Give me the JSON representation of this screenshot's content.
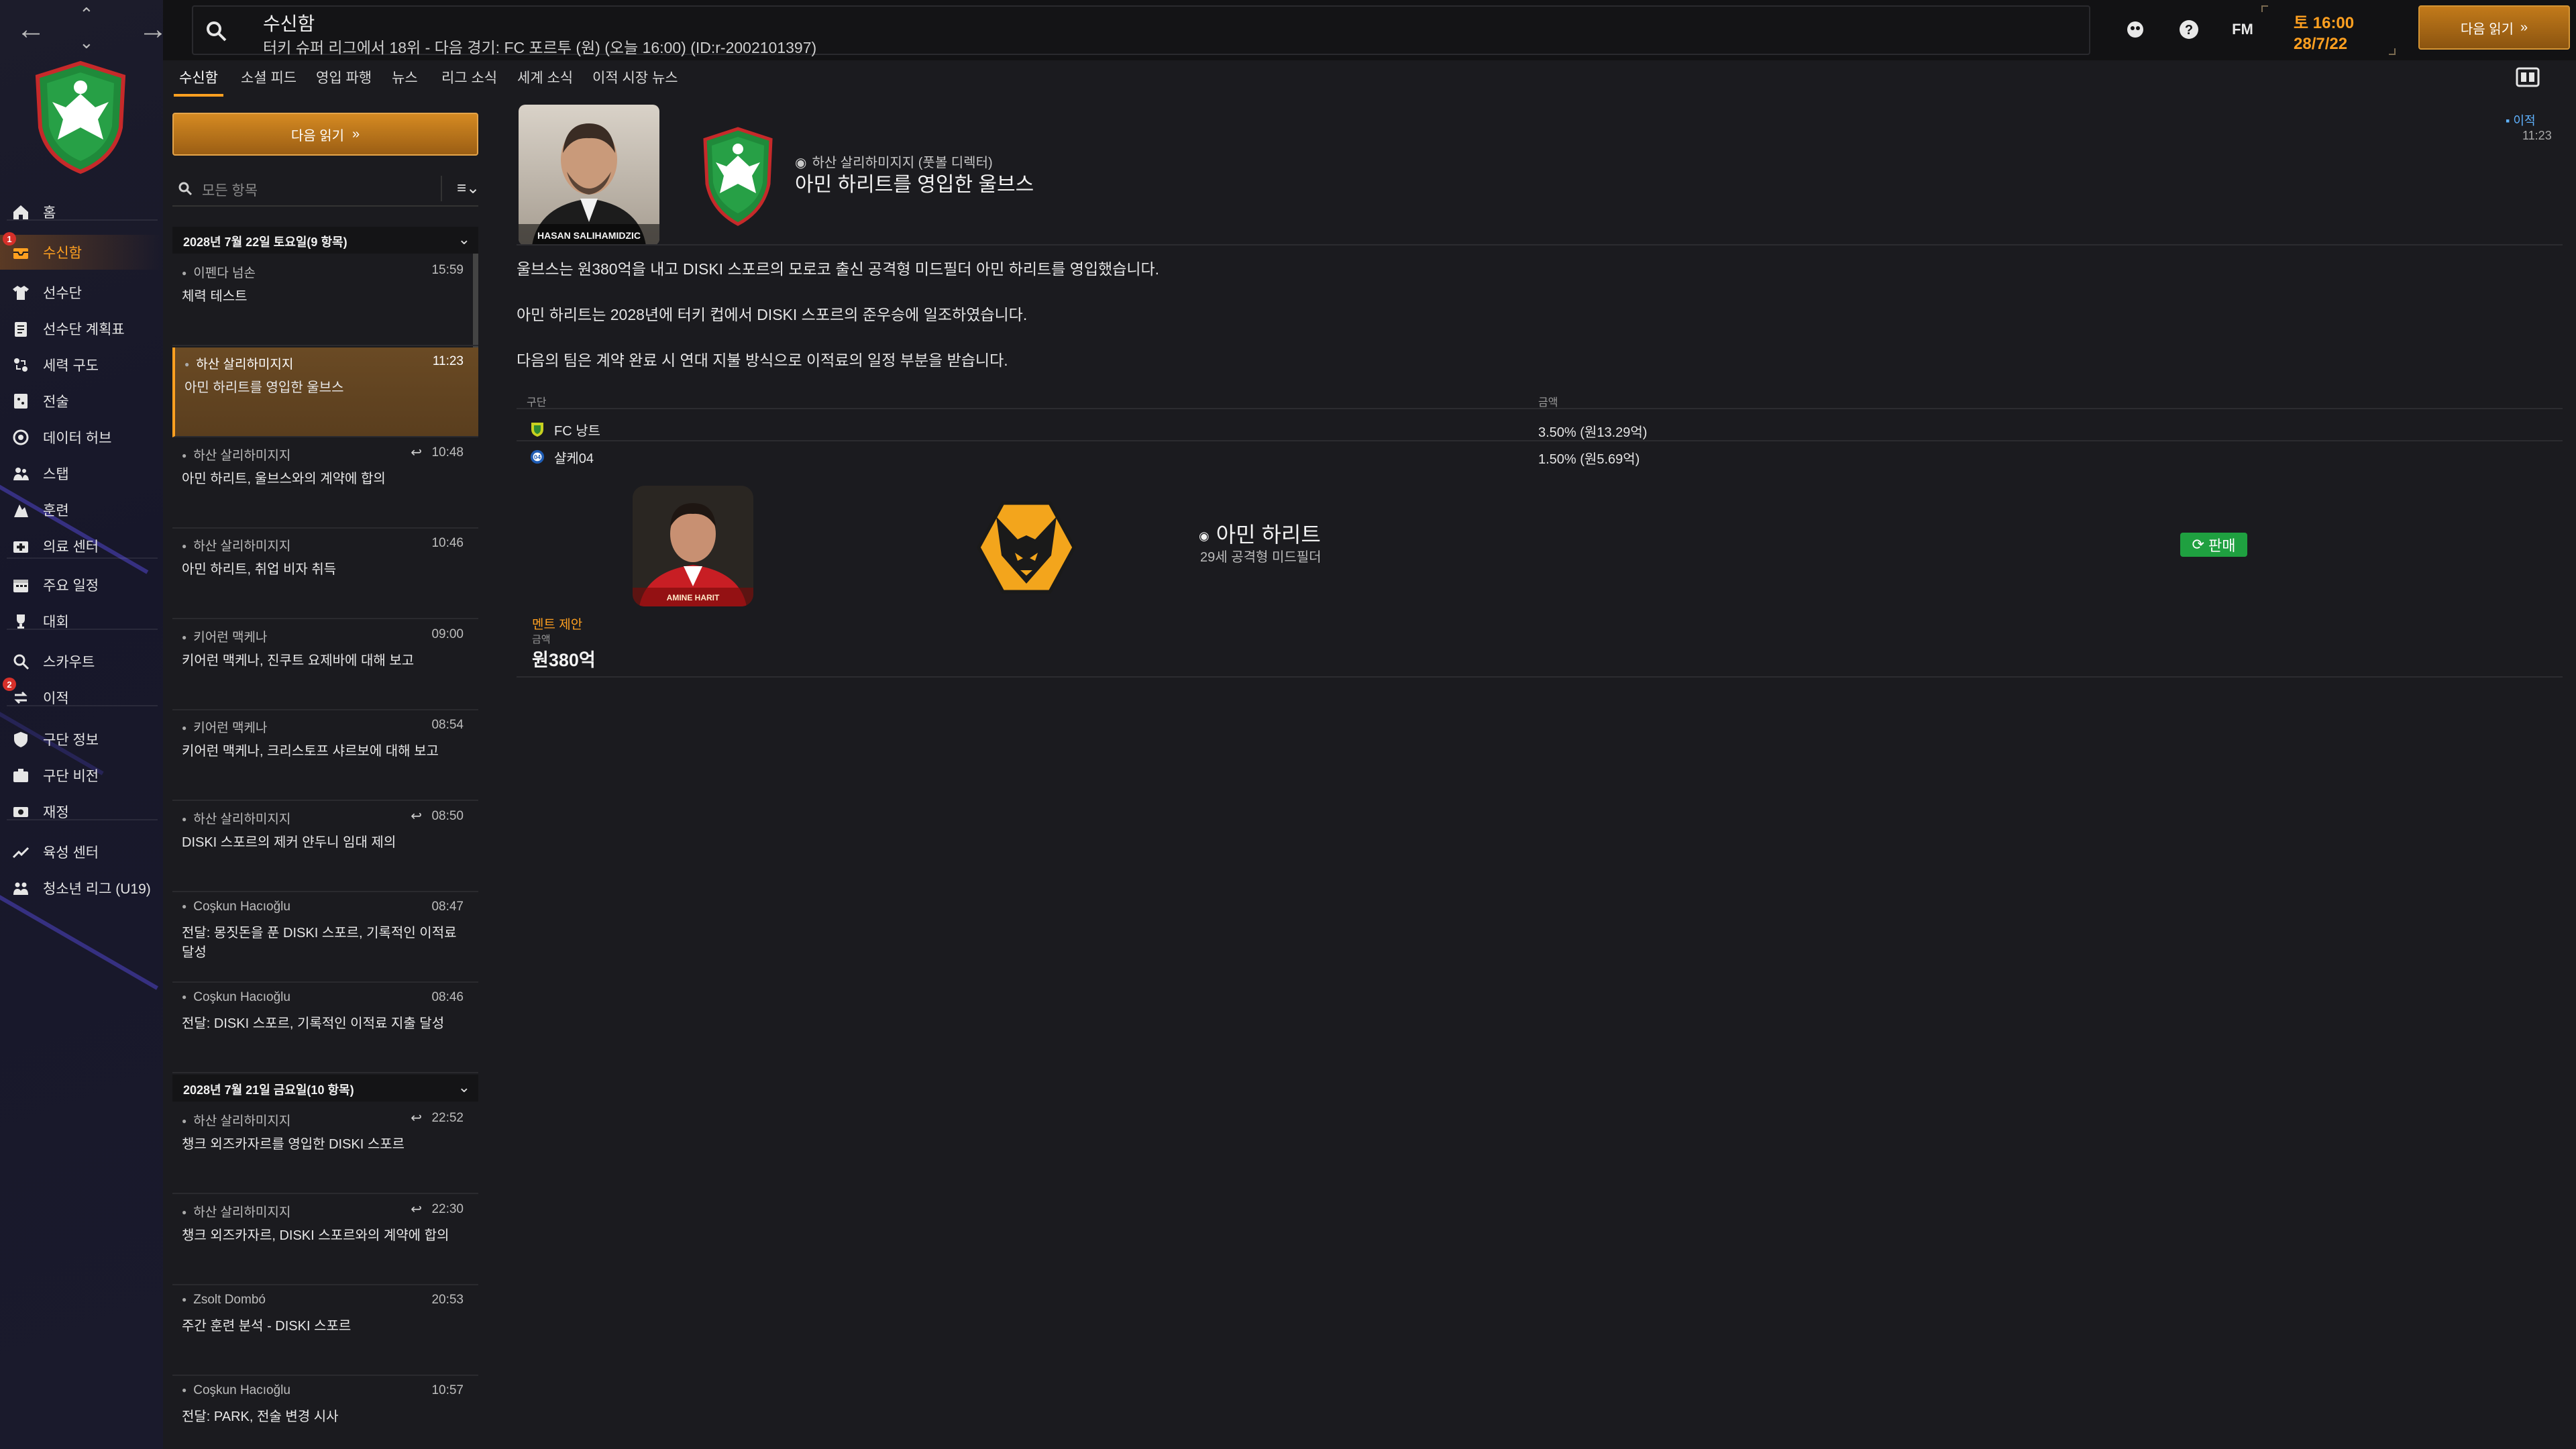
{
  "nav": {
    "back_icon": "arrow-left-icon",
    "forward_icon": "arrow-right-icon"
  },
  "topbar": {
    "title": "수신함",
    "subtitle": "터키 슈퍼 리그에서 18위 - 다음 경기: FC 포르투 (원) (오늘 16:00) (ID:r-2002101397)",
    "date_line1": "토 16:00",
    "date_line2": "28/7/22",
    "fm_label": "FM",
    "continue_label": "다음 읽기"
  },
  "sidebar": {
    "items": [
      {
        "label": "홈",
        "icon": "home-icon"
      },
      {
        "label": "수신함",
        "icon": "inbox-icon",
        "badge": "1",
        "active": true
      },
      {
        "label": "선수단",
        "icon": "shirt-icon"
      },
      {
        "label": "선수단 계획표",
        "icon": "clipboard-icon"
      },
      {
        "label": "세력 구도",
        "icon": "dynamics-icon"
      },
      {
        "label": "전술",
        "icon": "tactics-icon"
      },
      {
        "label": "데이터 허브",
        "icon": "data-hub-icon"
      },
      {
        "label": "스탭",
        "icon": "staff-icon"
      },
      {
        "label": "훈련",
        "icon": "training-icon"
      },
      {
        "label": "의료 센터",
        "icon": "medical-icon"
      },
      {
        "label": "주요 일정",
        "icon": "calendar-icon"
      },
      {
        "label": "대회",
        "icon": "trophy-icon"
      },
      {
        "label": "스카우트",
        "icon": "scouting-icon"
      },
      {
        "label": "이적",
        "icon": "transfers-icon",
        "badge": "2"
      },
      {
        "label": "구단 정보",
        "icon": "club-info-icon"
      },
      {
        "label": "구단 비전",
        "icon": "vision-icon"
      },
      {
        "label": "재정",
        "icon": "finances-icon"
      },
      {
        "label": "육성 센터",
        "icon": "development-icon"
      },
      {
        "label": "청소년 리그 (U19)",
        "icon": "youth-icon"
      }
    ]
  },
  "subnav": {
    "tabs": [
      "수신함",
      "소셜 피드",
      "영입 파행",
      "뉴스",
      "리그 소식",
      "세계 소식",
      "이적 시장 뉴스"
    ]
  },
  "inbox": {
    "continue_label": "다음 읽기",
    "filter_placeholder": "모든 항목",
    "groups": [
      {
        "header": "2028년 7월 22일 토요일(9 항목)"
      },
      {
        "header": "2028년 7월 21일 금요일(10 항목)"
      }
    ],
    "messages": [
      {
        "from": "이펜다 넘손",
        "time": "15:59",
        "subject": "체력 테스트",
        "reply": false
      },
      {
        "from": "하산 살리하미지지",
        "time": "11:23",
        "subject": "아민 하리트를 영입한 울브스",
        "reply": false
      },
      {
        "from": "하산 살리하미지지",
        "time": "10:48",
        "subject": "아민 하리트, 울브스와의 계약에 합의",
        "reply": true
      },
      {
        "from": "하산 살리하미지지",
        "time": "10:46",
        "subject": "아민 하리트, 취업 비자 취득",
        "reply": false
      },
      {
        "from": "키어런 맥케나",
        "time": "09:00",
        "subject": "키어런 맥케나, 진쿠트 요제바에 대해 보고",
        "reply": false
      },
      {
        "from": "키어런 맥케나",
        "time": "08:54",
        "subject": "키어런 맥케나, 크리스토프 샤르보에 대해 보고",
        "reply": false
      },
      {
        "from": "하산 살리하미지지",
        "time": "08:50",
        "subject": "DISKI 스포르의 제커 얀두니 임대 제의",
        "reply": true
      },
      {
        "from": "Coşkun Hacıoğlu",
        "time": "08:47",
        "subject": "전달: 몽짓돈을 푼 DISKI 스포르, 기록적인 이적료 달성",
        "reply": false
      },
      {
        "from": "Coşkun Hacıoğlu",
        "time": "08:46",
        "subject": "전달: DISKI 스포르, 기록적인 이적료 지출 달성",
        "reply": false
      },
      {
        "from": "하산 살리하미지지",
        "time": "22:52",
        "subject": "챙크 외즈카자르를 영입한 DISKI 스포르",
        "reply": true
      },
      {
        "from": "하산 살리하미지지",
        "time": "22:30",
        "subject": "챙크 외즈카자르, DISKI 스포르와의 계약에 합의",
        "reply": true
      },
      {
        "from": "Zsolt Dombó",
        "time": "20:53",
        "subject": "주간 훈련 분석 - DISKI 스포르",
        "reply": false
      },
      {
        "from": "Coşkun Hacıoğlu",
        "time": "10:57",
        "subject": "전달: PARK, 전술 변경 시사",
        "reply": false
      }
    ]
  },
  "message": {
    "photo_caption": "HASAN SALIHAMIDZIC",
    "from": "하산 살리하미지지 (풋볼 디렉터)",
    "title": "아민 하리트를 영입한 울브스",
    "tag": "이적",
    "time": "11:23",
    "paragraphs": [
      "울브스는 원380억을 내고 DISKI 스포르의 모로코 출신 공격형 미드필더 아민 하리트를 영입했습니다.",
      "아민 하리트는 2028년에 터키 컵에서 DISKI 스포르의 준우승에 일조하였습니다.",
      "다음의 팀은 계약 완료 시 연대 지불 방식으로 이적료의 일정 부분을 받습니다."
    ],
    "table": {
      "col_club": "구단",
      "col_amount": "금액",
      "rows": [
        {
          "club": "FC 낭트",
          "amount": "3.50% (원13.29억)",
          "color": "#c8d020"
        },
        {
          "club": "샬케04",
          "amount": "1.50% (원5.69억)",
          "color": "#1e5cb4"
        }
      ]
    },
    "player": {
      "card_caption": "AMINE HARIT",
      "name": "아민 하리트",
      "desc": "29세 공격형 미드필더",
      "sale_label": "판매"
    },
    "fee": {
      "label": "멘트 제안",
      "sub": "금액",
      "value": "원380억"
    }
  },
  "colors": {
    "accent": "#ffa020",
    "sale": "#1fa040",
    "tag": "#5fb2ff"
  }
}
